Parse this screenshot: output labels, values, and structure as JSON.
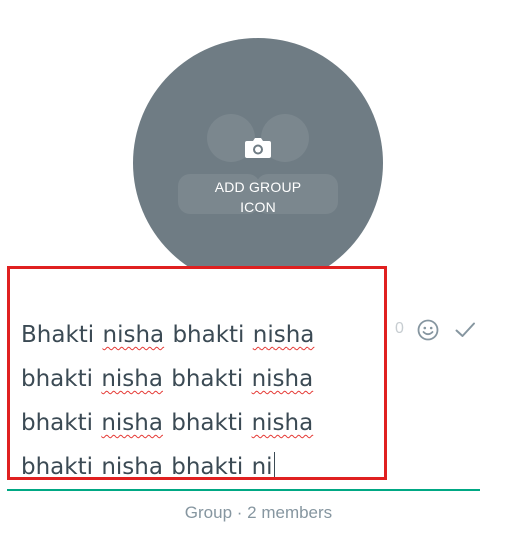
{
  "group_icon": {
    "label": "ADD GROUP\nICON",
    "icon": "camera-icon",
    "background_color": "#6f7c84"
  },
  "group_name": {
    "lines": [
      [
        {
          "text": "Bhakti",
          "misspelled": false
        },
        {
          "text": "nisha",
          "misspelled": true
        },
        {
          "text": "bhakti",
          "misspelled": false
        },
        {
          "text": "nisha",
          "misspelled": true
        }
      ],
      [
        {
          "text": "bhakti",
          "misspelled": false
        },
        {
          "text": "nisha",
          "misspelled": true
        },
        {
          "text": "bhakti",
          "misspelled": false
        },
        {
          "text": "nisha",
          "misspelled": true
        }
      ],
      [
        {
          "text": "bhakti",
          "misspelled": false
        },
        {
          "text": "nisha",
          "misspelled": true
        },
        {
          "text": "bhakti",
          "misspelled": false
        },
        {
          "text": "nisha",
          "misspelled": true
        }
      ],
      [
        {
          "text": "bhakti",
          "misspelled": false
        },
        {
          "text": "nisha",
          "misspelled": true
        },
        {
          "text": "bhakti",
          "misspelled": false
        },
        {
          "text": "ni",
          "misspelled": false
        }
      ]
    ],
    "char_count": "0",
    "highlight_color": "#e02020"
  },
  "actions": {
    "emoji_icon": "smiley-icon",
    "confirm_icon": "checkmark-icon"
  },
  "accent_color": "#00a884",
  "members_text": "Group · 2 members"
}
